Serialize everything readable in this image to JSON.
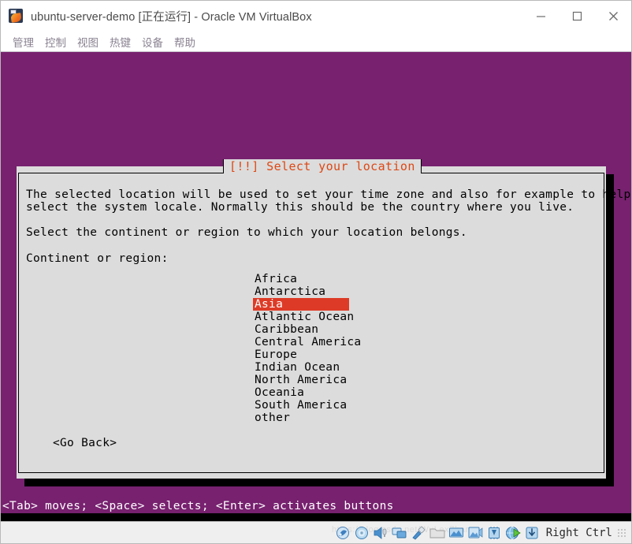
{
  "window": {
    "title": "ubuntu-server-demo [正在运行] - Oracle VM VirtualBox",
    "icon": "virtualbox-icon",
    "controls": {
      "minimize": "minimize-button",
      "maximize": "maximize-button",
      "close": "close-button"
    }
  },
  "menubar": {
    "items": [
      {
        "label": "管理"
      },
      {
        "label": "控制"
      },
      {
        "label": "视图"
      },
      {
        "label": "热键"
      },
      {
        "label": "设备"
      },
      {
        "label": "帮助"
      }
    ]
  },
  "installer": {
    "dialog_title": "[!!] Select your location",
    "paragraph1_line1": "The selected location will be used to set your time zone and also for example to help",
    "paragraph1_line2": "select the system locale. Normally this should be the country where you live.",
    "paragraph2": "Select the continent or region to which your location belongs.",
    "field_label": "Continent or region:",
    "options": [
      {
        "label": "Africa",
        "selected": false
      },
      {
        "label": "Antarctica",
        "selected": false
      },
      {
        "label": "Asia",
        "selected": true
      },
      {
        "label": "Atlantic Ocean",
        "selected": false
      },
      {
        "label": "Caribbean",
        "selected": false
      },
      {
        "label": "Central America",
        "selected": false
      },
      {
        "label": "Europe",
        "selected": false
      },
      {
        "label": "Indian Ocean",
        "selected": false
      },
      {
        "label": "North America",
        "selected": false
      },
      {
        "label": "Oceania",
        "selected": false
      },
      {
        "label": "South America",
        "selected": false
      },
      {
        "label": "other",
        "selected": false
      }
    ],
    "go_back_button": "<Go Back>",
    "hint_bar": "<Tab> moves; <Space> selects; <Enter> activates buttons",
    "colors": {
      "background": "#77216f",
      "dialog": "#dcdcdc",
      "title_accent": "#dd4814",
      "selection": "#dd3b27"
    }
  },
  "statusbar": {
    "icons": [
      {
        "name": "hard-disk-icon"
      },
      {
        "name": "optical-disk-icon"
      },
      {
        "name": "audio-icon"
      },
      {
        "name": "network-icon"
      },
      {
        "name": "usb-icon"
      },
      {
        "name": "shared-folders-icon"
      },
      {
        "name": "display-icon"
      },
      {
        "name": "video-capture-icon"
      },
      {
        "name": "virtualization-icon"
      },
      {
        "name": "remote-desktop-icon"
      },
      {
        "name": "mouse-integration-icon"
      }
    ],
    "host_key": "Right Ctrl",
    "watermark": "https://blog.csdn.net/WuLexZhang"
  }
}
